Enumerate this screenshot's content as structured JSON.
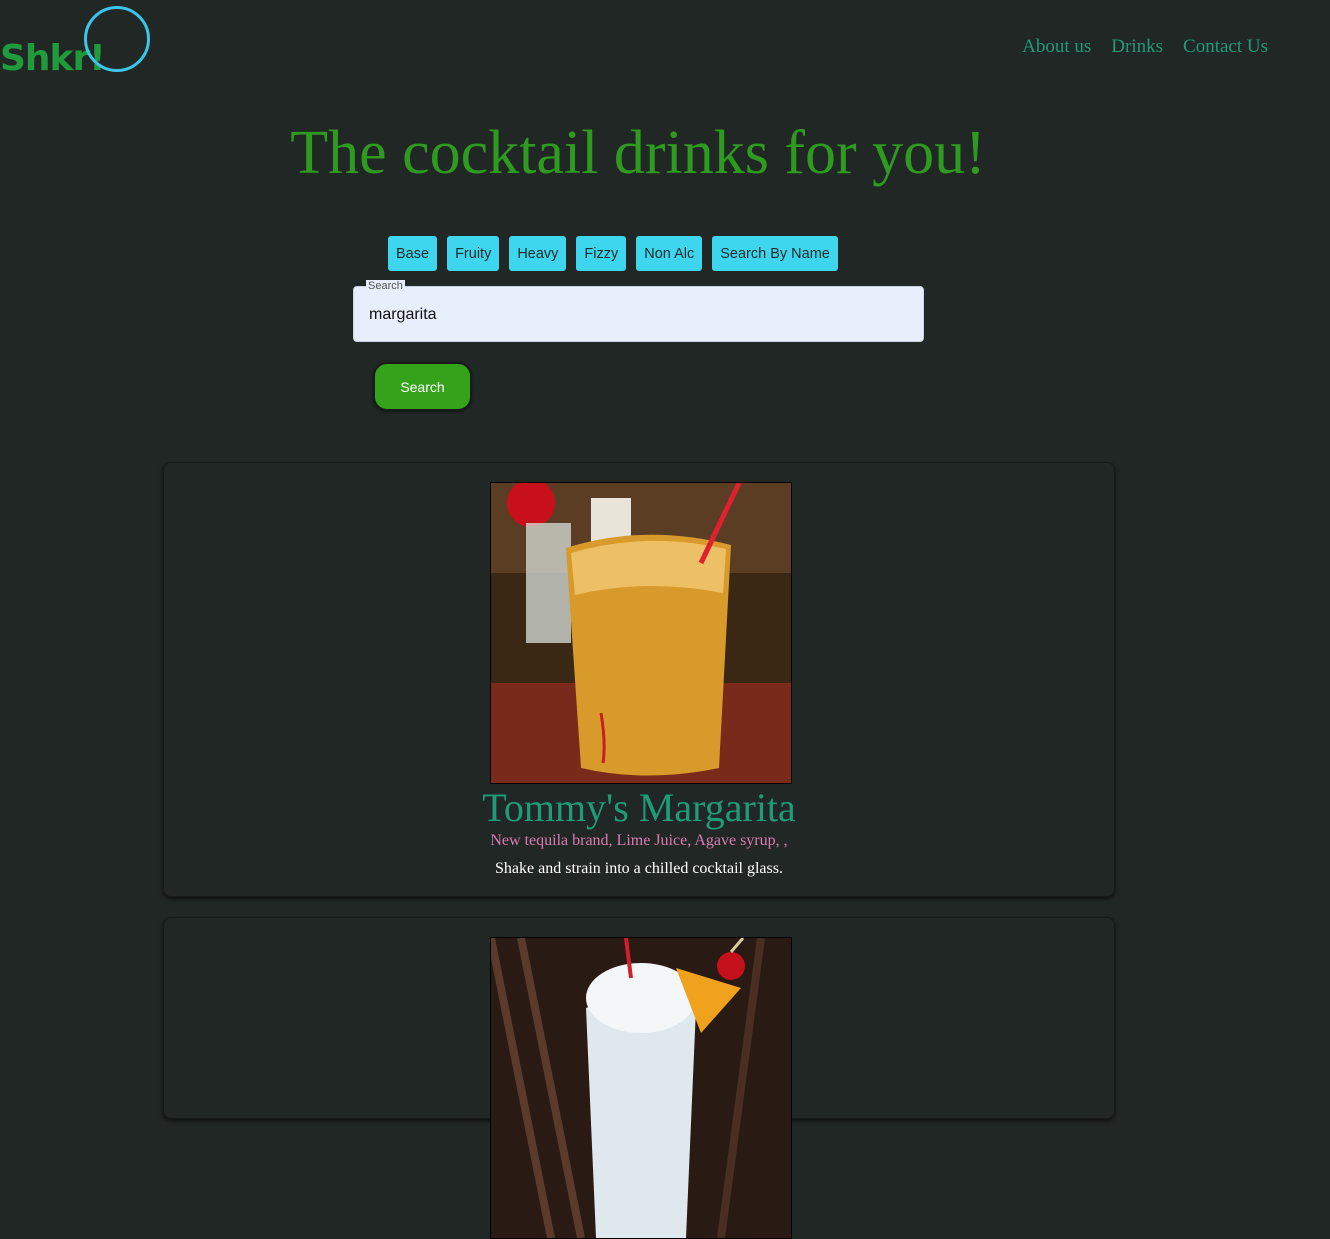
{
  "header": {
    "logo": "Shkr!",
    "nav": [
      "About us",
      "Drinks",
      "Contact Us"
    ]
  },
  "hero": {
    "title": "The cocktail drinks for you!"
  },
  "filters": [
    "Base",
    "Fruity",
    "Heavy",
    "Fizzy",
    "Non Alc",
    "Search By Name"
  ],
  "search": {
    "label": "Search",
    "value": "margarita",
    "button": "Search"
  },
  "results": [
    {
      "name": "Tommy's Margarita",
      "ingredients": "New tequila brand, Lime Juice, Agave syrup, ,",
      "instructions": "Shake and strain into a chilled cocktail glass."
    }
  ],
  "colors": {
    "background": "#212725",
    "brand": "#1f9b3c",
    "accent": "#3ed6ee",
    "search_button": "#35a31a"
  }
}
